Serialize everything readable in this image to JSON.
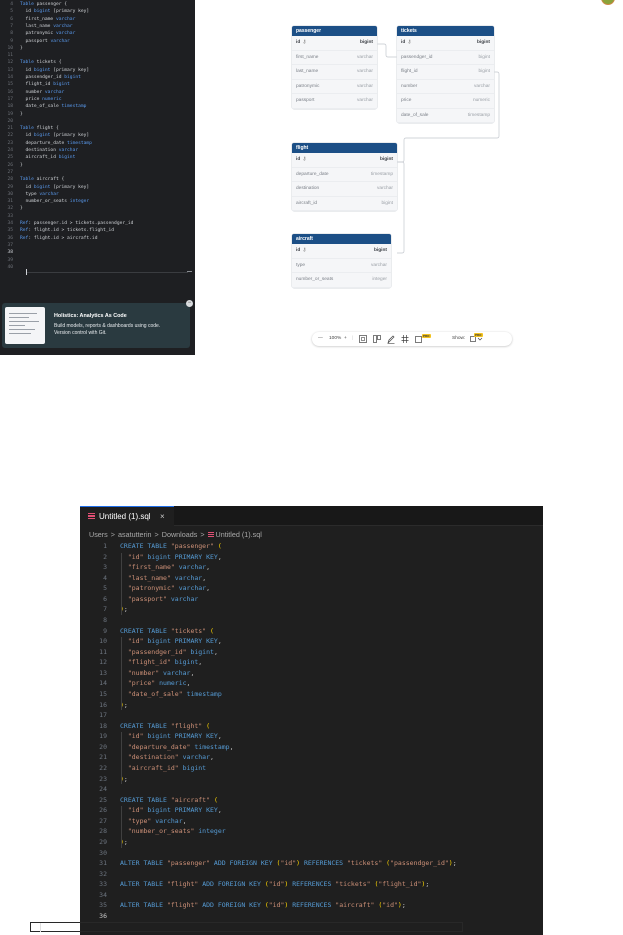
{
  "dbml_editor": {
    "lines": [
      {
        "n": "4",
        "segs": [
          [
            "kw",
            "Table "
          ],
          [
            "t",
            "passenger {"
          ]
        ]
      },
      {
        "n": "5",
        "segs": [
          [
            "t",
            "  id "
          ],
          [
            "ty",
            "bigint"
          ],
          [
            "t",
            " [primary key]"
          ]
        ]
      },
      {
        "n": "6",
        "segs": [
          [
            "t",
            "  first_name "
          ],
          [
            "ty",
            "varchar"
          ]
        ]
      },
      {
        "n": "7",
        "segs": [
          [
            "t",
            "  last_name "
          ],
          [
            "ty",
            "varchar"
          ]
        ]
      },
      {
        "n": "8",
        "segs": [
          [
            "t",
            "  patronymic "
          ],
          [
            "ty",
            "varchar"
          ]
        ]
      },
      {
        "n": "9",
        "segs": [
          [
            "t",
            "  passport "
          ],
          [
            "ty",
            "varchar"
          ]
        ]
      },
      {
        "n": "10",
        "segs": [
          [
            "t",
            "}"
          ]
        ]
      },
      {
        "n": "11",
        "segs": []
      },
      {
        "n": "12",
        "segs": [
          [
            "kw",
            "Table "
          ],
          [
            "t",
            "tickets {"
          ]
        ]
      },
      {
        "n": "13",
        "segs": [
          [
            "t",
            "  id "
          ],
          [
            "ty",
            "bigint"
          ],
          [
            "t",
            " [primary key]"
          ]
        ]
      },
      {
        "n": "14",
        "segs": [
          [
            "t",
            "  passendger_id "
          ],
          [
            "ty",
            "bigint"
          ]
        ]
      },
      {
        "n": "15",
        "segs": [
          [
            "t",
            "  flight_id "
          ],
          [
            "ty",
            "bigint"
          ]
        ]
      },
      {
        "n": "16",
        "segs": [
          [
            "t",
            "  number "
          ],
          [
            "ty",
            "varchar"
          ]
        ]
      },
      {
        "n": "17",
        "segs": [
          [
            "t",
            "  price "
          ],
          [
            "ty",
            "numeric"
          ]
        ]
      },
      {
        "n": "18",
        "segs": [
          [
            "t",
            "  date_of_sale "
          ],
          [
            "ty",
            "timestamp"
          ]
        ]
      },
      {
        "n": "19",
        "segs": [
          [
            "t",
            "}"
          ]
        ]
      },
      {
        "n": "20",
        "segs": []
      },
      {
        "n": "21",
        "segs": [
          [
            "kw",
            "Table "
          ],
          [
            "t",
            "flight {"
          ]
        ]
      },
      {
        "n": "22",
        "segs": [
          [
            "t",
            "  id "
          ],
          [
            "ty",
            "bigint"
          ],
          [
            "t",
            " [primary key]"
          ]
        ]
      },
      {
        "n": "23",
        "segs": [
          [
            "t",
            "  departure_date "
          ],
          [
            "ty",
            "timestamp"
          ]
        ]
      },
      {
        "n": "24",
        "segs": [
          [
            "t",
            "  destination "
          ],
          [
            "ty",
            "varchar"
          ]
        ]
      },
      {
        "n": "25",
        "segs": [
          [
            "t",
            "  aircraft_id "
          ],
          [
            "ty",
            "bigint"
          ]
        ]
      },
      {
        "n": "26",
        "segs": [
          [
            "t",
            "}"
          ]
        ]
      },
      {
        "n": "27",
        "segs": []
      },
      {
        "n": "28",
        "segs": [
          [
            "kw",
            "Table "
          ],
          [
            "t",
            "aircraft {"
          ]
        ]
      },
      {
        "n": "29",
        "segs": [
          [
            "t",
            "  id "
          ],
          [
            "ty",
            "bigint"
          ],
          [
            "t",
            " [primary key]"
          ]
        ]
      },
      {
        "n": "30",
        "segs": [
          [
            "t",
            "  type "
          ],
          [
            "ty",
            "varchar"
          ]
        ]
      },
      {
        "n": "31",
        "segs": [
          [
            "t",
            "  number_or_seats "
          ],
          [
            "ty",
            "integer"
          ]
        ]
      },
      {
        "n": "32",
        "segs": [
          [
            "t",
            "}"
          ]
        ]
      },
      {
        "n": "33",
        "segs": []
      },
      {
        "n": "34",
        "segs": [
          [
            "ref",
            "Ref"
          ],
          [
            "t",
            ": passenger.id > tickets.passendger_id"
          ]
        ]
      },
      {
        "n": "35",
        "segs": [
          [
            "ref",
            "Ref"
          ],
          [
            "t",
            ": flight.id > tickets.flight_id"
          ]
        ]
      },
      {
        "n": "36",
        "segs": [
          [
            "ref",
            "Ref"
          ],
          [
            "t",
            ": flight.id > aircraft.id"
          ]
        ]
      },
      {
        "n": "37",
        "segs": []
      },
      {
        "n": "38",
        "segs": [],
        "current": true
      },
      {
        "n": "39",
        "segs": []
      },
      {
        "n": "40",
        "segs": []
      }
    ]
  },
  "promo": {
    "title": "Holistics: Analytics As Code",
    "line1": "Build models, reports & dashboards using code.",
    "line2": "Version control with Git.",
    "close": "−"
  },
  "tables": [
    {
      "name": "passenger",
      "key": "passenger",
      "cols": [
        [
          "id",
          "bigint",
          true
        ],
        [
          "first_name",
          "varchar",
          false
        ],
        [
          "last_name",
          "varchar",
          false
        ],
        [
          "patronymic",
          "varchar",
          false
        ],
        [
          "passport",
          "varchar",
          false
        ]
      ]
    },
    {
      "name": "tickets",
      "key": "tickets",
      "cols": [
        [
          "id",
          "bigint",
          true
        ],
        [
          "passendger_id",
          "bigint",
          false
        ],
        [
          "flight_id",
          "bigint",
          false
        ],
        [
          "number",
          "varchar",
          false
        ],
        [
          "price",
          "numeric",
          false
        ],
        [
          "date_of_sale",
          "timestamp",
          false
        ]
      ]
    },
    {
      "name": "flight",
      "key": "flight",
      "cols": [
        [
          "id",
          "bigint",
          true
        ],
        [
          "departure_date",
          "timestamp",
          false
        ],
        [
          "destination",
          "varchar",
          false
        ],
        [
          "aircraft_id",
          "bigint",
          false
        ]
      ]
    },
    {
      "name": "aircraft",
      "key": "aircraft",
      "cols": [
        [
          "id",
          "bigint",
          true
        ],
        [
          "type",
          "varchar",
          false
        ],
        [
          "number_or_seats",
          "integer",
          false
        ]
      ]
    }
  ],
  "toolbar": {
    "zoom_out": "—",
    "zoom": "100%",
    "zoom_in": "+",
    "show_label": "Show:",
    "pro_label": "PRO"
  },
  "vscode": {
    "tab_label": "Untitled (1).sql",
    "tab_close": "×",
    "breadcrumb": [
      "Users",
      "asatutterin",
      "Downloads",
      "Untitled (1).sql"
    ],
    "lines": [
      {
        "n": "1",
        "segs": [
          [
            "k",
            "CREATE TABLE "
          ],
          [
            "s",
            "\"passenger\""
          ],
          [
            "d",
            " "
          ],
          [
            "p",
            "("
          ]
        ]
      },
      {
        "n": "2",
        "segs": [
          [
            "d",
            "  "
          ],
          [
            "s",
            "\"id\""
          ],
          [
            "k",
            " bigint PRIMARY KEY"
          ],
          [
            "d",
            ","
          ]
        ]
      },
      {
        "n": "3",
        "segs": [
          [
            "d",
            "  "
          ],
          [
            "s",
            "\"first_name\""
          ],
          [
            "k",
            " varchar"
          ],
          [
            "d",
            ","
          ]
        ]
      },
      {
        "n": "4",
        "segs": [
          [
            "d",
            "  "
          ],
          [
            "s",
            "\"last_name\""
          ],
          [
            "k",
            " varchar"
          ],
          [
            "d",
            ","
          ]
        ]
      },
      {
        "n": "5",
        "segs": [
          [
            "d",
            "  "
          ],
          [
            "s",
            "\"patronymic\""
          ],
          [
            "k",
            " varchar"
          ],
          [
            "d",
            ","
          ]
        ]
      },
      {
        "n": "6",
        "segs": [
          [
            "d",
            "  "
          ],
          [
            "s",
            "\"passport\""
          ],
          [
            "k",
            " varchar"
          ]
        ]
      },
      {
        "n": "7",
        "segs": [
          [
            "p",
            ")"
          ],
          [
            "d",
            ";"
          ]
        ]
      },
      {
        "n": "8",
        "segs": []
      },
      {
        "n": "9",
        "segs": [
          [
            "k",
            "CREATE TABLE "
          ],
          [
            "s",
            "\"tickets\""
          ],
          [
            "d",
            " "
          ],
          [
            "p",
            "("
          ]
        ]
      },
      {
        "n": "10",
        "segs": [
          [
            "d",
            "  "
          ],
          [
            "s",
            "\"id\""
          ],
          [
            "k",
            " bigint PRIMARY KEY"
          ],
          [
            "d",
            ","
          ]
        ]
      },
      {
        "n": "11",
        "segs": [
          [
            "d",
            "  "
          ],
          [
            "s",
            "\"passendger_id\""
          ],
          [
            "k",
            " bigint"
          ],
          [
            "d",
            ","
          ]
        ]
      },
      {
        "n": "12",
        "segs": [
          [
            "d",
            "  "
          ],
          [
            "s",
            "\"flight_id\""
          ],
          [
            "k",
            " bigint"
          ],
          [
            "d",
            ","
          ]
        ]
      },
      {
        "n": "13",
        "segs": [
          [
            "d",
            "  "
          ],
          [
            "s",
            "\"number\""
          ],
          [
            "k",
            " varchar"
          ],
          [
            "d",
            ","
          ]
        ]
      },
      {
        "n": "14",
        "segs": [
          [
            "d",
            "  "
          ],
          [
            "s",
            "\"price\""
          ],
          [
            "k",
            " numeric"
          ],
          [
            "d",
            ","
          ]
        ]
      },
      {
        "n": "15",
        "segs": [
          [
            "d",
            "  "
          ],
          [
            "s",
            "\"date_of_sale\""
          ],
          [
            "k",
            " timestamp"
          ]
        ]
      },
      {
        "n": "16",
        "segs": [
          [
            "p",
            ")"
          ],
          [
            "d",
            ";"
          ]
        ]
      },
      {
        "n": "17",
        "segs": []
      },
      {
        "n": "18",
        "segs": [
          [
            "k",
            "CREATE TABLE "
          ],
          [
            "s",
            "\"flight\""
          ],
          [
            "d",
            " "
          ],
          [
            "p",
            "("
          ]
        ]
      },
      {
        "n": "19",
        "segs": [
          [
            "d",
            "  "
          ],
          [
            "s",
            "\"id\""
          ],
          [
            "k",
            " bigint PRIMARY KEY"
          ],
          [
            "d",
            ","
          ]
        ]
      },
      {
        "n": "20",
        "segs": [
          [
            "d",
            "  "
          ],
          [
            "s",
            "\"departure_date\""
          ],
          [
            "k",
            " timestamp"
          ],
          [
            "d",
            ","
          ]
        ]
      },
      {
        "n": "21",
        "segs": [
          [
            "d",
            "  "
          ],
          [
            "s",
            "\"destination\""
          ],
          [
            "k",
            " varchar"
          ],
          [
            "d",
            ","
          ]
        ]
      },
      {
        "n": "22",
        "segs": [
          [
            "d",
            "  "
          ],
          [
            "s",
            "\"aircraft_id\""
          ],
          [
            "k",
            " bigint"
          ]
        ]
      },
      {
        "n": "23",
        "segs": [
          [
            "p",
            ")"
          ],
          [
            "d",
            ";"
          ]
        ]
      },
      {
        "n": "24",
        "segs": []
      },
      {
        "n": "25",
        "segs": [
          [
            "k",
            "CREATE TABLE "
          ],
          [
            "s",
            "\"aircraft\""
          ],
          [
            "d",
            " "
          ],
          [
            "p",
            "("
          ]
        ]
      },
      {
        "n": "26",
        "segs": [
          [
            "d",
            "  "
          ],
          [
            "s",
            "\"id\""
          ],
          [
            "k",
            " bigint PRIMARY KEY"
          ],
          [
            "d",
            ","
          ]
        ]
      },
      {
        "n": "27",
        "segs": [
          [
            "d",
            "  "
          ],
          [
            "s",
            "\"type\""
          ],
          [
            "k",
            " varchar"
          ],
          [
            "d",
            ","
          ]
        ]
      },
      {
        "n": "28",
        "segs": [
          [
            "d",
            "  "
          ],
          [
            "s",
            "\"number_or_seats\""
          ],
          [
            "k",
            " integer"
          ]
        ]
      },
      {
        "n": "29",
        "segs": [
          [
            "p",
            ")"
          ],
          [
            "d",
            ";"
          ]
        ]
      },
      {
        "n": "30",
        "segs": []
      },
      {
        "n": "31",
        "segs": [
          [
            "k",
            "ALTER TABLE "
          ],
          [
            "s",
            "\"passenger\""
          ],
          [
            "k",
            " ADD FOREIGN KEY "
          ],
          [
            "p",
            "("
          ],
          [
            "s",
            "\"id\""
          ],
          [
            "p",
            ")"
          ],
          [
            "k",
            " REFERENCES "
          ],
          [
            "s",
            "\"tickets\""
          ],
          [
            "d",
            " "
          ],
          [
            "p",
            "("
          ],
          [
            "s",
            "\"passendger_id\""
          ],
          [
            "p",
            ")"
          ],
          [
            "d",
            ";"
          ]
        ]
      },
      {
        "n": "32",
        "segs": []
      },
      {
        "n": "33",
        "segs": [
          [
            "k",
            "ALTER TABLE "
          ],
          [
            "s",
            "\"flight\""
          ],
          [
            "k",
            " ADD FOREIGN KEY "
          ],
          [
            "p",
            "("
          ],
          [
            "s",
            "\"id\""
          ],
          [
            "p",
            ")"
          ],
          [
            "k",
            " REFERENCES "
          ],
          [
            "s",
            "\"tickets\""
          ],
          [
            "d",
            " "
          ],
          [
            "p",
            "("
          ],
          [
            "s",
            "\"flight_id\""
          ],
          [
            "p",
            ")"
          ],
          [
            "d",
            ";"
          ]
        ]
      },
      {
        "n": "34",
        "segs": []
      },
      {
        "n": "35",
        "segs": [
          [
            "k",
            "ALTER TABLE "
          ],
          [
            "s",
            "\"flight\""
          ],
          [
            "k",
            " ADD FOREIGN KEY "
          ],
          [
            "p",
            "("
          ],
          [
            "s",
            "\"id\""
          ],
          [
            "p",
            ")"
          ],
          [
            "k",
            " REFERENCES "
          ],
          [
            "s",
            "\"aircraft\""
          ],
          [
            "d",
            " "
          ],
          [
            "p",
            "("
          ],
          [
            "s",
            "\"id\""
          ],
          [
            "p",
            ")"
          ],
          [
            "d",
            ";"
          ]
        ]
      },
      {
        "n": "36",
        "segs": [],
        "current": true
      }
    ]
  },
  "colors": {
    "table_header": "#1c4f86",
    "editor_bg": "#1e1f22",
    "vscode_bg": "#1f1f1f",
    "sql_keyword": "#569cd6",
    "sql_string": "#ce9178"
  }
}
